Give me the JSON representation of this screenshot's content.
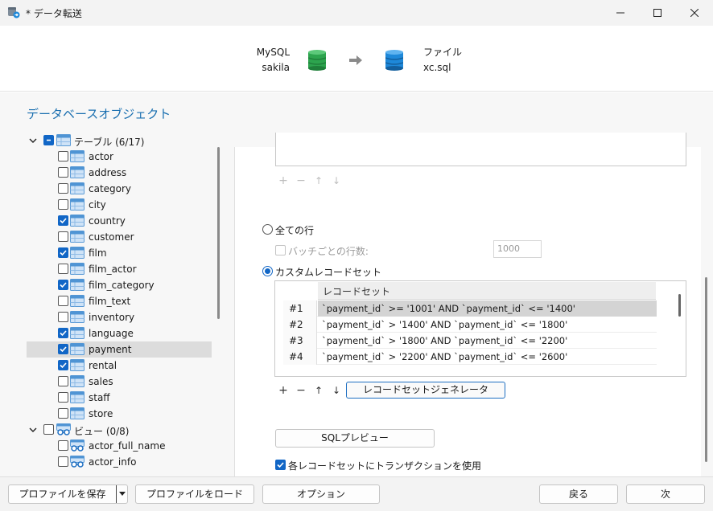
{
  "window": {
    "title": "* データ転送",
    "minimize_icon": "minimize-icon",
    "maximize_icon": "maximize-icon",
    "close_icon": "close-icon"
  },
  "header": {
    "source_type": "MySQL",
    "source_name": "sakila",
    "target_type": "ファイル",
    "target_name": "xc.sql",
    "source_icon_color": "#2da44e",
    "target_icon_color": "#1e88d9"
  },
  "section_title": "データベースオブジェクト",
  "tree": {
    "tables_group": {
      "label": "テーブル (6/17)",
      "expanded": true,
      "state": "partial"
    },
    "tables": [
      {
        "label": "actor",
        "checked": false
      },
      {
        "label": "address",
        "checked": false
      },
      {
        "label": "category",
        "checked": false
      },
      {
        "label": "city",
        "checked": false
      },
      {
        "label": "country",
        "checked": true
      },
      {
        "label": "customer",
        "checked": false
      },
      {
        "label": "film",
        "checked": true
      },
      {
        "label": "film_actor",
        "checked": false
      },
      {
        "label": "film_category",
        "checked": true
      },
      {
        "label": "film_text",
        "checked": false
      },
      {
        "label": "inventory",
        "checked": false
      },
      {
        "label": "language",
        "checked": true
      },
      {
        "label": "payment",
        "checked": true,
        "selected": true
      },
      {
        "label": "rental",
        "checked": true
      },
      {
        "label": "sales",
        "checked": false
      },
      {
        "label": "staff",
        "checked": false
      },
      {
        "label": "store",
        "checked": false
      }
    ],
    "views_group": {
      "label": "ビュー (0/8)",
      "expanded": true,
      "state": "unchecked"
    },
    "views": [
      {
        "label": "actor_full_name",
        "checked": false
      },
      {
        "label": "actor_info",
        "checked": false
      }
    ]
  },
  "options": {
    "all_rows_label": "全ての行",
    "batch_label": "バッチごとの行数:",
    "batch_value": "1000",
    "custom_label": "カスタムレコードセット",
    "custom_selected": true
  },
  "recordsets": {
    "column_header": "レコードセット",
    "rows": [
      {
        "num": "#1",
        "value": "`payment_id` >= '1001' AND `payment_id` <= '1400'"
      },
      {
        "num": "#2",
        "value": "`payment_id` > '1400' AND `payment_id` <= '1800'"
      },
      {
        "num": "#3",
        "value": "`payment_id` > '1800' AND `payment_id` <= '2200'"
      },
      {
        "num": "#4",
        "value": "`payment_id` > '2200' AND `payment_id` <= '2600'"
      }
    ],
    "generator_button": "レコードセットジェネレータ"
  },
  "toolbar": {
    "add": "+",
    "remove": "−",
    "up": "↑",
    "down": "↓"
  },
  "sql_preview_button": "SQLプレビュー",
  "transaction_label": "各レコードセットにトランザクションを使用",
  "transaction_checked": true,
  "footer": {
    "save_profile": "プロファイルを保存",
    "load_profile": "プロファイルをロード",
    "options": "オプション",
    "back": "戻る",
    "next": "次"
  }
}
